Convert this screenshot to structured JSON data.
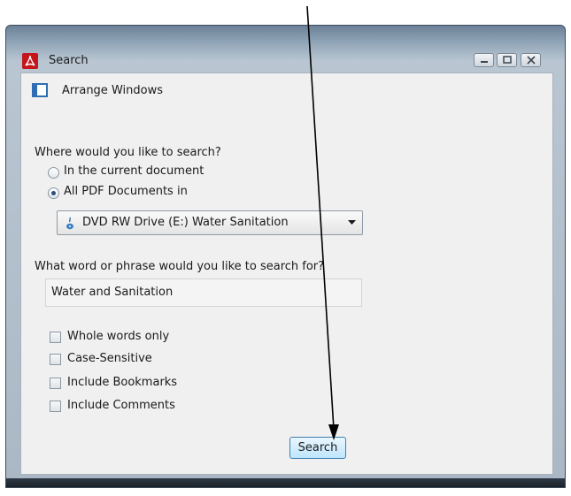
{
  "window": {
    "title": "Search",
    "app_icon": "adobe-reader-icon",
    "controls": [
      "minimize-icon",
      "maximize-icon",
      "close-icon"
    ]
  },
  "toolbar": {
    "arrange_label": "Arrange Windows",
    "arrange_icon": "arrange-windows-icon"
  },
  "scope": {
    "question": "Where would you like to search?",
    "options": [
      {
        "label": "In the current document",
        "checked": false
      },
      {
        "label": "All PDF Documents in",
        "checked": true
      }
    ],
    "location_select": {
      "value": "DVD RW Drive (E:) Water Sanitation",
      "icon": "disc-drive-icon"
    }
  },
  "query": {
    "question": "What word or phrase would you like to search for?",
    "value": "Water and Sanitation"
  },
  "options": [
    {
      "label": "Whole words only",
      "checked": false
    },
    {
      "label": "Case-Sensitive",
      "checked": false
    },
    {
      "label": "Include Bookmarks",
      "checked": false
    },
    {
      "label": "Include Comments",
      "checked": false
    }
  ],
  "actions": {
    "search_label": "Search"
  },
  "colors": {
    "accent": "#3c7fb1",
    "app_icon": "#c4161c",
    "annotation_arrow": "#000000"
  }
}
